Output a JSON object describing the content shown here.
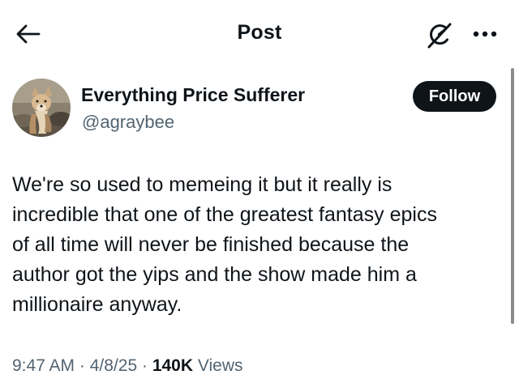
{
  "header": {
    "title": "Post",
    "back_icon": "arrow-left-icon",
    "grok_icon": "grok-icon",
    "more_icon": "more-horizontal-icon"
  },
  "author": {
    "display_name": "Everything Price Sufferer",
    "handle": "@agraybee",
    "avatar_icon": "avatar-photo",
    "follow_label": "Follow"
  },
  "post": {
    "lines": [
      "We're so used to memeing it but it really is",
      "incredible that one of the greatest fantasy epics",
      "of all time will never be finished because the",
      "author got the yips and the show made him a",
      "millionaire anyway."
    ],
    "time": "9:47 AM",
    "date": "4/8/25",
    "separator": "·",
    "views_count": "140K",
    "views_label": "Views"
  },
  "colors": {
    "text_primary": "#0f1419",
    "text_secondary": "#536471",
    "follow_bg": "#0f1419",
    "follow_text": "#ffffff",
    "scrollbar": "#8b8b8b"
  }
}
